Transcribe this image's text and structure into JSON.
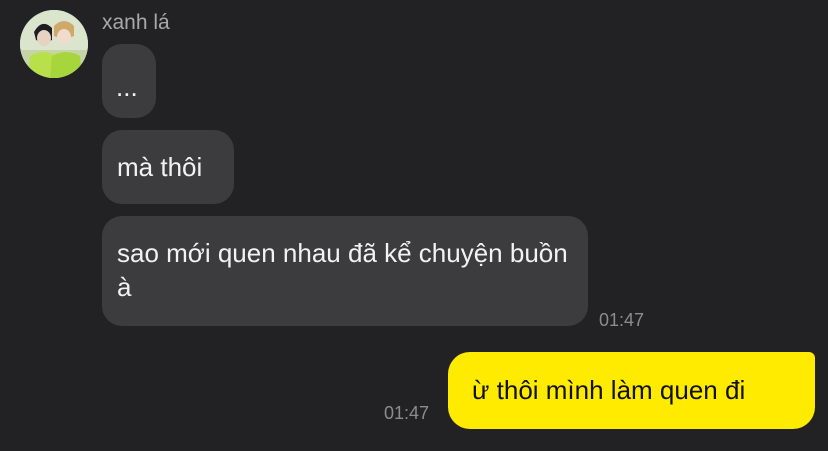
{
  "chat": {
    "contact": {
      "name": "xanh lá",
      "avatar": "profile-photo"
    },
    "messages": [
      {
        "sender": "contact",
        "text": "..."
      },
      {
        "sender": "contact",
        "text": "mà thôi"
      },
      {
        "sender": "contact",
        "text": "sao mới quen nhau đã kể chuyện buồn à",
        "time": "01:47"
      },
      {
        "sender": "me",
        "text": "ừ thôi mình làm quen đi",
        "time": "01:47"
      }
    ]
  },
  "colors": {
    "background": "#222224",
    "incoming_bubble": "#3c3c3e",
    "outgoing_bubble": "#ffeb00",
    "timestamp": "#8c8c8e"
  }
}
